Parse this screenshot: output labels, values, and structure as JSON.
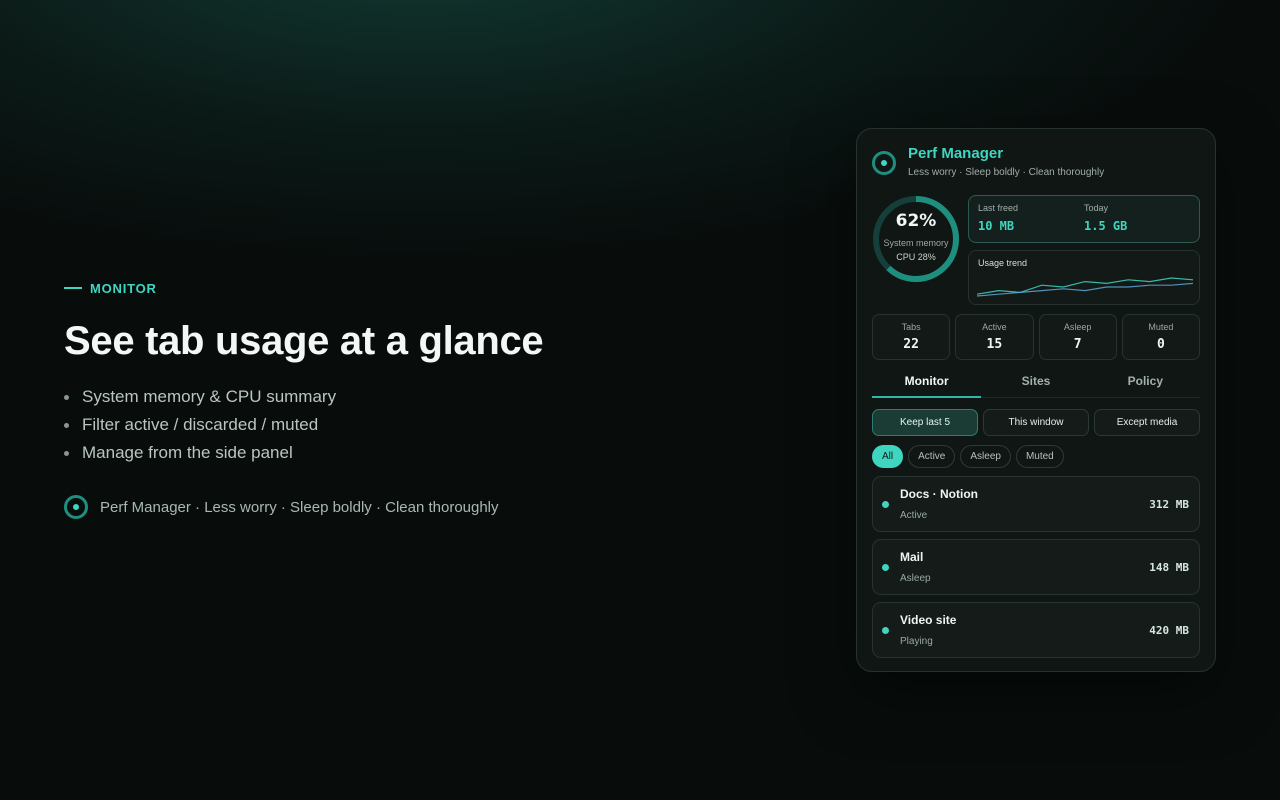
{
  "hero": {
    "eyebrow": "MONITOR",
    "headline": "See tab usage at a glance",
    "bullets": [
      "System memory & CPU summary",
      "Filter active / discarded / muted",
      "Manage from the side panel"
    ],
    "brandline": "Perf Manager · Less worry · Sleep boldly · Clean thoroughly"
  },
  "panel": {
    "title": "Perf Manager",
    "subtitle": "Less worry · Sleep boldly · Clean thoroughly",
    "gauge": {
      "value": "62%",
      "fraction": 0.62,
      "label": "System memory",
      "cpu": "CPU 28%"
    },
    "freed": {
      "last_label": "Last freed",
      "last_value": "10 MB",
      "today_label": "Today",
      "today_value": "1.5 GB"
    },
    "trend": {
      "label": "Usage trend",
      "series_a": [
        2,
        4,
        3,
        7,
        6,
        9,
        8,
        10,
        9,
        11,
        10
      ],
      "series_b": [
        1,
        2,
        3,
        4,
        5,
        4,
        6,
        6,
        7,
        7,
        8
      ]
    },
    "stats": [
      {
        "label": "Tabs",
        "value": "22"
      },
      {
        "label": "Active",
        "value": "15"
      },
      {
        "label": "Asleep",
        "value": "7"
      },
      {
        "label": "Muted",
        "value": "0"
      }
    ],
    "tabs": [
      "Monitor",
      "Sites",
      "Policy"
    ],
    "presets": [
      "Keep last 5",
      "This window",
      "Except media"
    ],
    "filters": [
      "All",
      "Active",
      "Asleep",
      "Muted"
    ],
    "items": [
      {
        "name": "Docs · Notion",
        "state": "Active",
        "mem": "312 MB"
      },
      {
        "name": "Mail",
        "state": "Asleep",
        "mem": "148 MB"
      },
      {
        "name": "Video site",
        "state": "Playing",
        "mem": "420 MB"
      }
    ]
  },
  "colors": {
    "accent": "#3fd6c0",
    "ring_track": "#1e8f7e",
    "background": "#080d0c"
  }
}
